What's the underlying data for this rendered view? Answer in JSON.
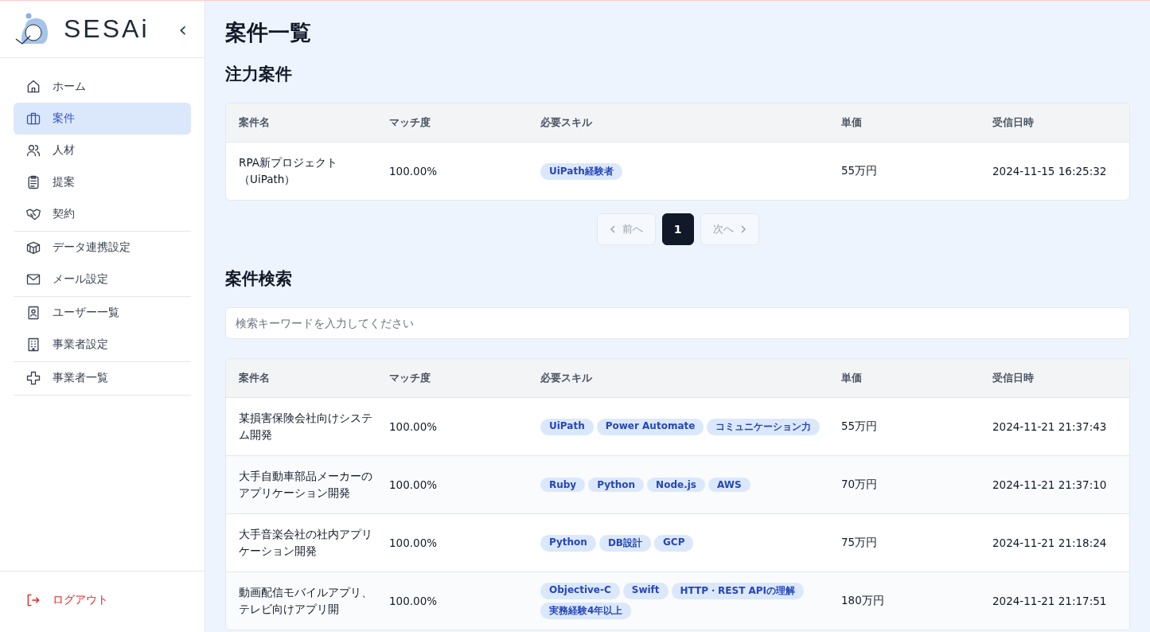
{
  "sidebar": {
    "logo": "SESAi",
    "collapse": "‹",
    "groups": [
      [
        {
          "label": "ホーム",
          "kind": "home",
          "selected": false
        },
        {
          "label": "案件",
          "kind": "briefcase",
          "selected": true
        },
        {
          "label": "人材",
          "kind": "users",
          "selected": false
        },
        {
          "label": "提案",
          "kind": "clipboard",
          "selected": false
        },
        {
          "label": "契約",
          "kind": "handshake",
          "selected": false
        }
      ],
      [
        {
          "label": "データ連携設定",
          "kind": "box",
          "selected": false
        },
        {
          "label": "メール設定",
          "kind": "mail",
          "selected": false
        }
      ],
      [
        {
          "label": "ユーザー一覧",
          "kind": "contact",
          "selected": false
        },
        {
          "label": "事業者設定",
          "kind": "building",
          "selected": false
        }
      ],
      [
        {
          "label": "事業者一覧",
          "kind": "plus",
          "selected": false
        }
      ]
    ],
    "logout": "ログアウト"
  },
  "page_title": "案件一覧",
  "featured": {
    "heading": "注力案件",
    "columns": [
      "案件名",
      "マッチ度",
      "必要スキル",
      "単価",
      "受信日時"
    ],
    "rows": [
      {
        "name": "RPA新プロジェクト（UiPath）",
        "match": "100.00%",
        "skills": [
          "UiPath経験者"
        ],
        "price": "55万円",
        "received": "2024-11-15 16:25:32"
      }
    ],
    "pagination": {
      "prev": "前へ",
      "pages": [
        {
          "label": "1",
          "selected": true
        }
      ],
      "next": "次へ",
      "prev_disabled": true,
      "next_disabled": true
    }
  },
  "search": {
    "heading": "案件検索",
    "placeholder": "検索キーワードを入力してください",
    "columns": [
      "案件名",
      "マッチ度",
      "必要スキル",
      "単価",
      "受信日時"
    ],
    "rows": [
      {
        "name": "某損害保険会社向けシステム開発",
        "match": "100.00%",
        "skills": [
          "UiPath",
          "Power Automate",
          "コミュニケーション力"
        ],
        "price": "55万円",
        "received": "2024-11-21 21:37:43"
      },
      {
        "name": "大手自動車部品メーカーのアプリケーション開発",
        "match": "100.00%",
        "skills": [
          "Ruby",
          "Python",
          "Node.js",
          "AWS"
        ],
        "price": "70万円",
        "received": "2024-11-21 21:37:10"
      },
      {
        "name": "大手音楽会社の社内アプリケーション開発",
        "match": "100.00%",
        "skills": [
          "Python",
          "DB設計",
          "GCP"
        ],
        "price": "75万円",
        "received": "2024-11-21 21:18:24"
      },
      {
        "name": "動画配信モバイルアプリ、テレビ向けアプリ開",
        "match": "100.00%",
        "skills": [
          "Objective-C",
          "Swift",
          "HTTP・REST APIの理解",
          "実務経験4年以上"
        ],
        "price": "180万円",
        "received": "2024-11-21 21:17:51"
      }
    ]
  }
}
